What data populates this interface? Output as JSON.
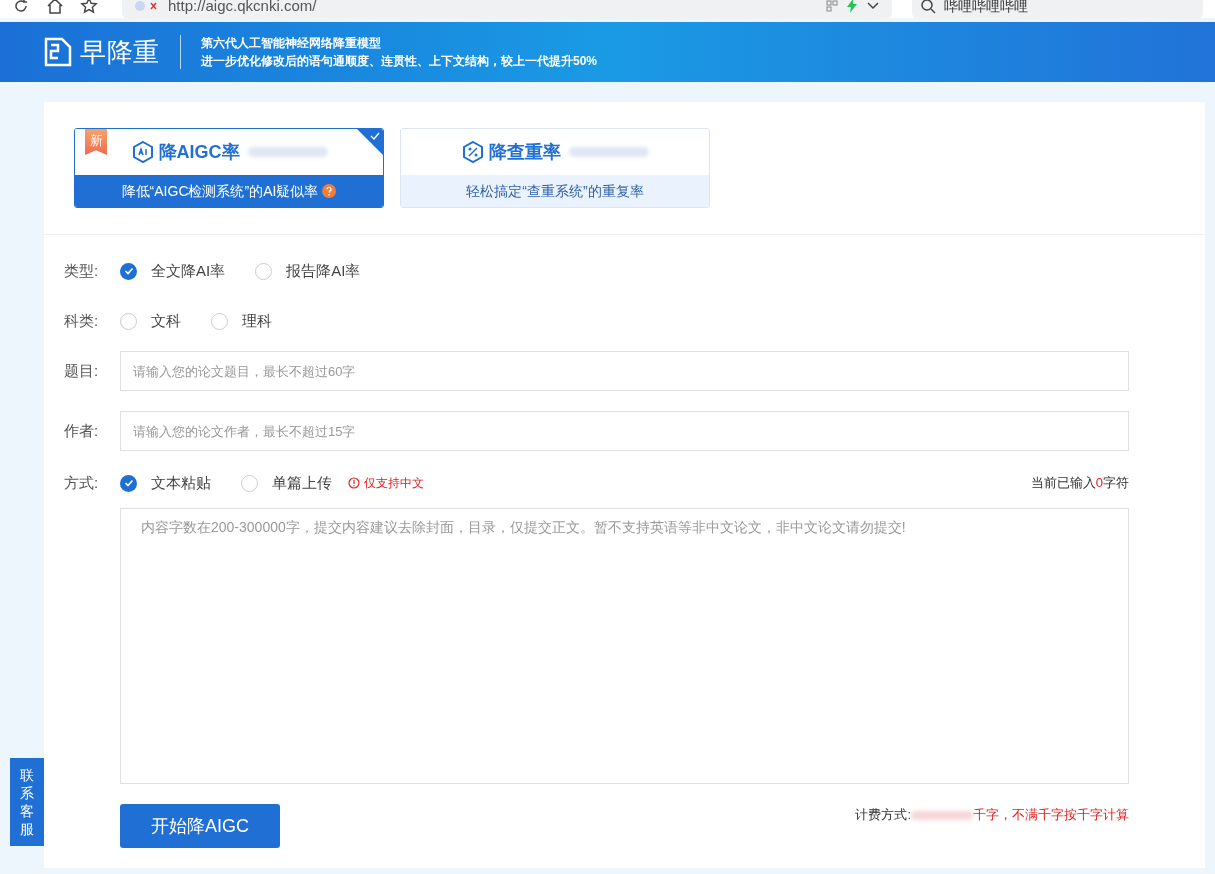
{
  "browser": {
    "url": "http://aigc.qkcnki.com/",
    "search": "哔哩哔哩哔哩"
  },
  "header": {
    "logo": "早降重",
    "tagline_1": "第六代人工智能神经网络降重模型",
    "tagline_2": "进一步优化修改后的语句通顺度、连贯性、上下文结构，较上一代提升50%"
  },
  "services": [
    {
      "title": "降AIGC率",
      "subtitle": "降低“AIGC检测系统”的AI疑似率",
      "badge": "新",
      "selected": true
    },
    {
      "title": "降查重率",
      "subtitle": "轻松搞定“查重系统”的重复率",
      "selected": false
    }
  ],
  "form": {
    "type": {
      "label": "类型:",
      "options": [
        {
          "label": "全文降AI率",
          "selected": true
        },
        {
          "label": "报告降AI率",
          "selected": false
        }
      ]
    },
    "subject": {
      "label": "科类:",
      "options": [
        {
          "label": "文科",
          "selected": false
        },
        {
          "label": "理科",
          "selected": false
        }
      ]
    },
    "title": {
      "label": "题目:",
      "placeholder": "请输入您的论文题目，最长不超过60字"
    },
    "author": {
      "label": "作者:",
      "placeholder": "请输入您的论文作者，最长不超过15字"
    },
    "mode": {
      "label": "方式:",
      "options": [
        {
          "label": "文本粘贴",
          "selected": true
        },
        {
          "label": "单篇上传",
          "selected": false
        }
      ],
      "notice": "仅支持中文",
      "count_prefix": "当前已输入",
      "count": "0",
      "count_suffix": "字符"
    },
    "content": {
      "placeholder": "内容字数在200-300000字，提交内容建议去除封面，目录，仅提交正文。暂不支持英语等非中文论文，非中文论文请勿提交!"
    },
    "submit": "开始降AIGC",
    "pricing_label": "计费方式:",
    "pricing_rule": "千字，不满千字按千字计算"
  },
  "contact": "联系客服"
}
